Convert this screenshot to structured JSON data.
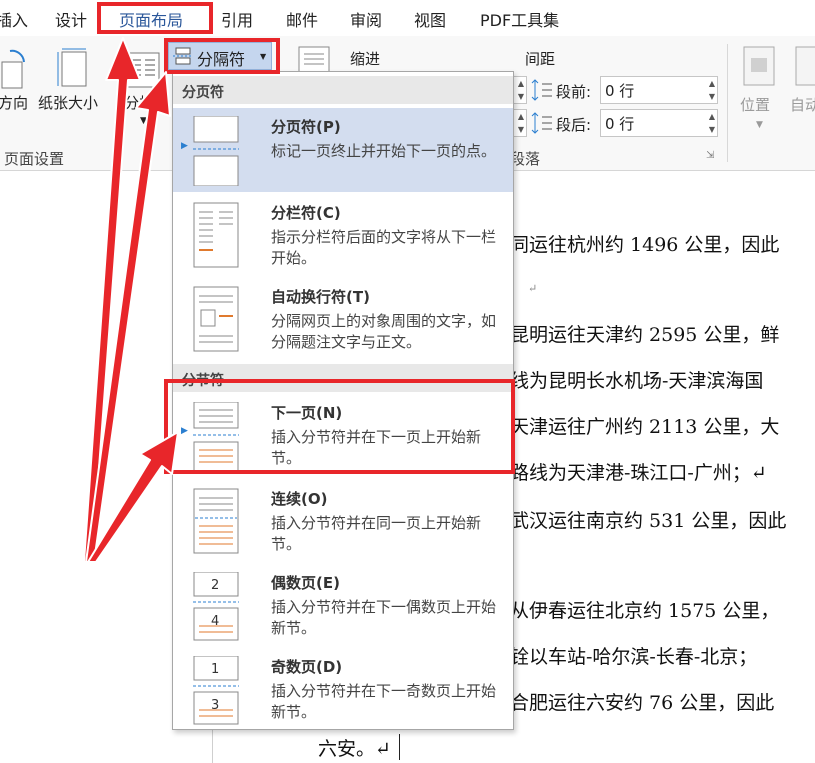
{
  "tabs": [
    "插入",
    "设计",
    "页面布局",
    "引用",
    "邮件",
    "审阅",
    "视图",
    "PDF工具集"
  ],
  "ribbon": {
    "orientation": "方向",
    "paper_size": "纸张大小",
    "columns": "分栏",
    "breaks_button": "分隔符",
    "indent_label": "缩进",
    "spacing_label": "间距",
    "before_label": "段前:",
    "before_value": "0 行",
    "after_label": "段后:",
    "after_value": "0 行",
    "group_page_setup": "页面设置",
    "group_paragraph": "段落",
    "position": "位置",
    "wrap_text": "自动"
  },
  "menu": {
    "page_breaks_header": "分页符",
    "section_breaks_header": "分节符",
    "items": [
      {
        "title": "分页符(P)",
        "desc": "标记一页终止并开始下一页的点。"
      },
      {
        "title": "分栏符(C)",
        "desc": "指示分栏符后面的文字将从下一栏开始。"
      },
      {
        "title": "自动换行符(T)",
        "desc": "分隔网页上的对象周围的文字，如分隔题注文字与正文。"
      },
      {
        "title": "下一页(N)",
        "desc": "插入分节符并在下一页上开始新节。"
      },
      {
        "title": "连续(O)",
        "desc": "插入分节符并在同一页上开始新节。"
      },
      {
        "title": "偶数页(E)",
        "desc": "插入分节符并在下一偶数页上开始新节。",
        "nums": [
          "2",
          "4"
        ]
      },
      {
        "title": "奇数页(D)",
        "desc": "插入分节符并在下一奇数页上开始新节。",
        "nums": [
          "1",
          "3"
        ]
      }
    ]
  },
  "doc_lines": [
    "同运往杭州约 1496 公里，因此",
    "↵",
    "昆明运往天津约 2595 公里，鲜",
    "线为昆明长水机场-天津滨海国",
    "天津运往广州约 2113 公里，大",
    "路线为天津港-珠江口-广州；↵",
    "武汉运往南京约 531 公里，因此",
    "从伊春运往北京约 1575 公里，",
    "铨以车站-哈尔滨-长春-北京；",
    "合肥运往六安约 76 公里，因此"
  ],
  "doc_last_line": "六安。↵",
  "colors": {
    "highlight": "#e8262a",
    "selected_item": "#d3ddef",
    "accent_orange": "#e07a2e"
  }
}
